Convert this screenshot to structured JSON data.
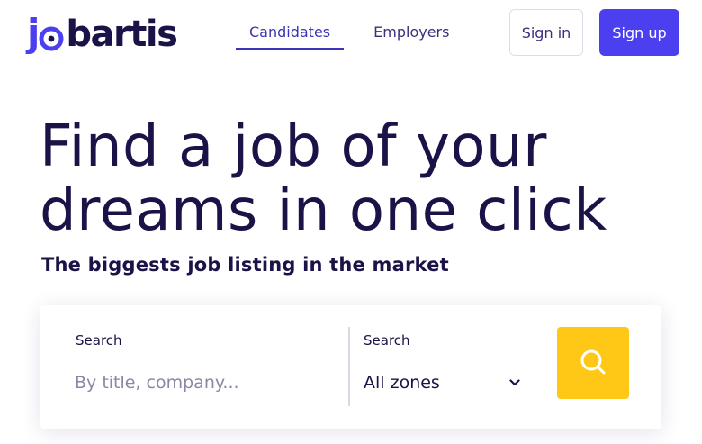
{
  "logo": {
    "j": "j",
    "text": "bartis"
  },
  "nav": {
    "tabs": [
      {
        "label": "Candidates",
        "active": true
      },
      {
        "label": "Employers",
        "active": false
      }
    ]
  },
  "auth": {
    "signin_label": "Sign in",
    "signup_label": "Sign up"
  },
  "hero": {
    "title": "Find a job of your dreams in one click",
    "subtitle": "The biggests job listing in the market"
  },
  "search": {
    "label_1": "Search",
    "placeholder": "By title, company...",
    "value": "",
    "label_2": "Search",
    "zone_selected": "All zones"
  },
  "icons": {
    "logo_mark": "location-pin-icon",
    "select": "chevron-down-icon",
    "search": "search-icon"
  },
  "colors": {
    "brand": "#4c3ff0",
    "text": "#1a1347",
    "accent_yellow": "#ffc817",
    "nav_active": "#3b34b8"
  }
}
